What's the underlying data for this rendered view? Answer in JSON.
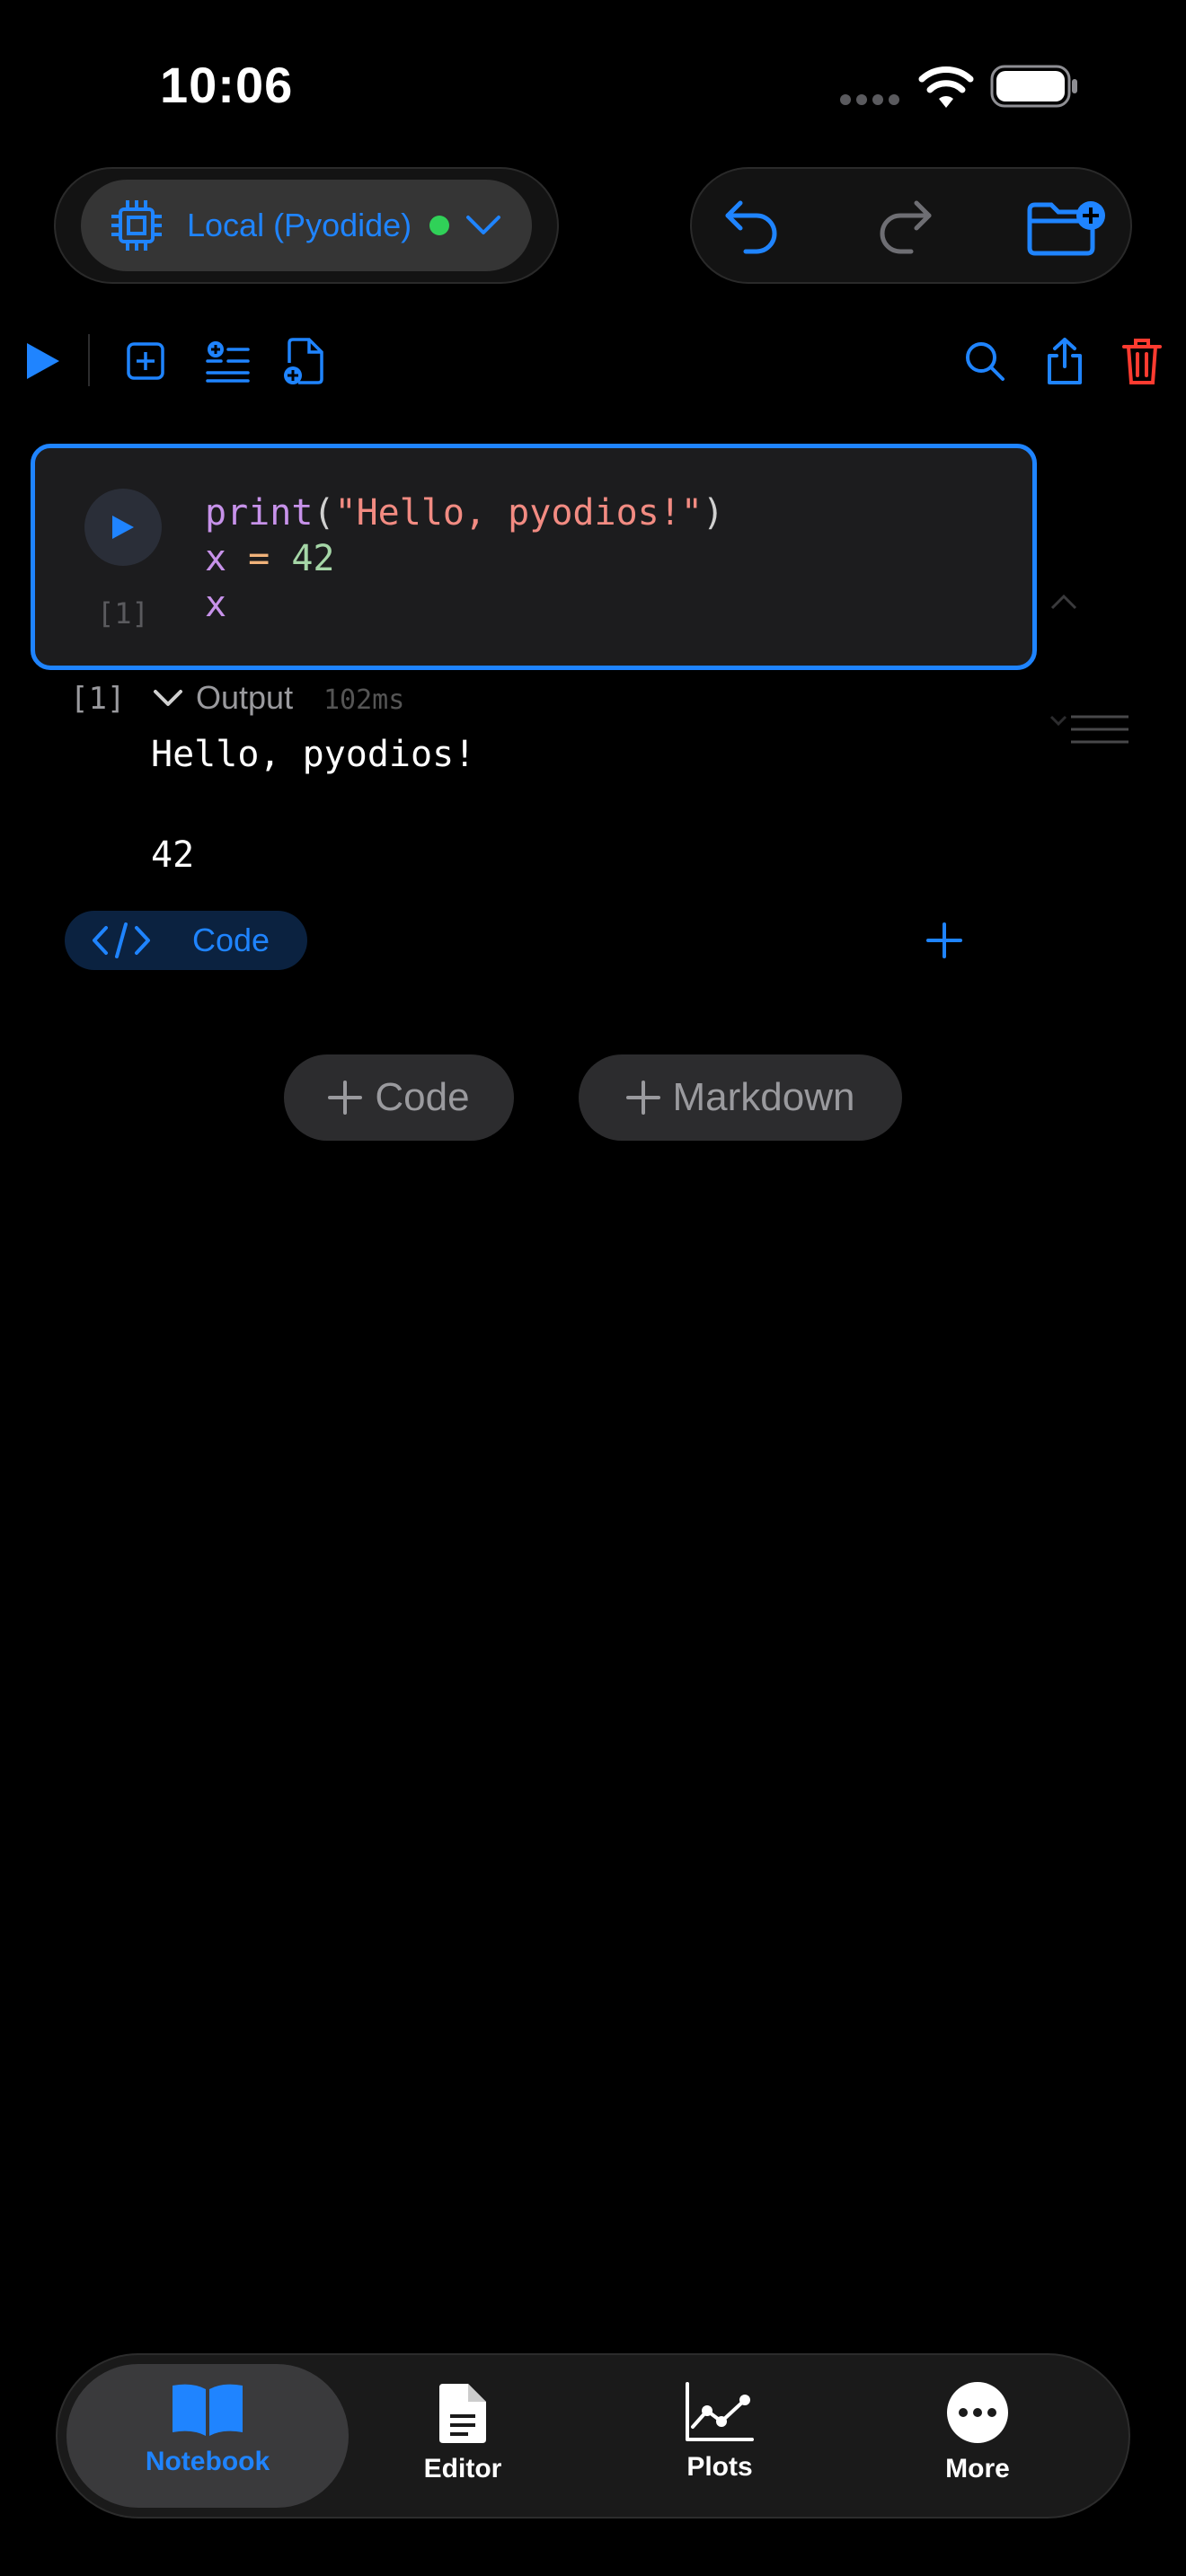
{
  "status_bar": {
    "time": "10:06"
  },
  "kernel": {
    "label": "Local (Pyodide)",
    "status_color": "#30d158"
  },
  "toolbar": {
    "left_icons": [
      "run-all-icon",
      "add-cell-icon",
      "add-list-icon",
      "new-document-icon"
    ],
    "right_icons": [
      "search-icon",
      "share-icon",
      "trash-icon"
    ]
  },
  "cell": {
    "execution_count": "[1]",
    "code": {
      "line1_fn": "print",
      "line1_open": "(",
      "line1_str": "\"Hello, pyodios!\"",
      "line1_close": ")",
      "line2_var": "x",
      "line2_eq": " = ",
      "line2_num": "42",
      "line3_var": "x"
    },
    "type_label": "Code"
  },
  "output": {
    "count": "[1]",
    "label": "Output",
    "duration": "102ms",
    "line1": "Hello, pyodios!",
    "line2": "42"
  },
  "add_buttons": {
    "code": "Code",
    "markdown": "Markdown"
  },
  "tabs": [
    {
      "label": "Notebook",
      "icon": "book-icon",
      "active": true
    },
    {
      "label": "Editor",
      "icon": "document-icon",
      "active": false
    },
    {
      "label": "Plots",
      "icon": "chart-icon",
      "active": false
    },
    {
      "label": "More",
      "icon": "ellipsis-icon",
      "active": false
    }
  ],
  "colors": {
    "accent": "#1f84ff",
    "danger": "#ff3b30",
    "keyword": "#c792ea",
    "string": "#f28b82",
    "number": "#a5d6a7"
  }
}
